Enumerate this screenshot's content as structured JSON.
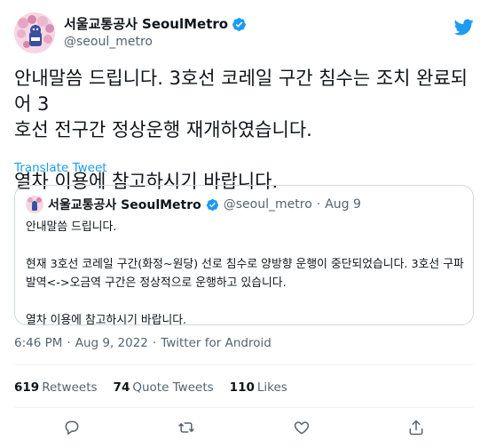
{
  "author": {
    "display_name": "서울교통공사 SeoulMetro",
    "handle": "@seoul_metro"
  },
  "tweet_text": "안내말씀 드립니다. 3호선 코레일 구간 침수는 조치 완료되어 3\n호선 전구간 정상운행 재개하였습니다.\n\n열차 이용에 참고하시기 바랍니다.",
  "translate_label": "Translate Tweet",
  "quote": {
    "display_name": "서울교통공사 SeoulMetro",
    "handle": "@seoul_metro",
    "separator": "·",
    "date": "Aug 9",
    "text": "안내말씀 드립니다.\n\n현재 3호선 코레일 구간(화정~원당) 선로 침수로 양방향 운행이 중단되었습니다. 3호선 구파\n발역<->오금역 구간은 정상적으로 운행하고 있습니다.\n\n열차 이용에 참고하시기 바랍니다."
  },
  "meta": {
    "time": "6:46 PM",
    "sep1": "·",
    "date": "Aug 9, 2022",
    "sep2": "·",
    "source": "Twitter for Android"
  },
  "stats": {
    "retweets_count": "619",
    "retweets_label": "Retweets",
    "quotes_count": "74",
    "quotes_label": "Quote Tweets",
    "likes_count": "110",
    "likes_label": "Likes"
  },
  "colors": {
    "accent": "#1d9bf0",
    "secondary_text": "#536471",
    "border": "#cfd9de"
  },
  "icons": [
    "verified-badge-icon",
    "twitter-logo-icon",
    "reply-icon",
    "retweet-icon",
    "like-icon",
    "share-icon"
  ]
}
